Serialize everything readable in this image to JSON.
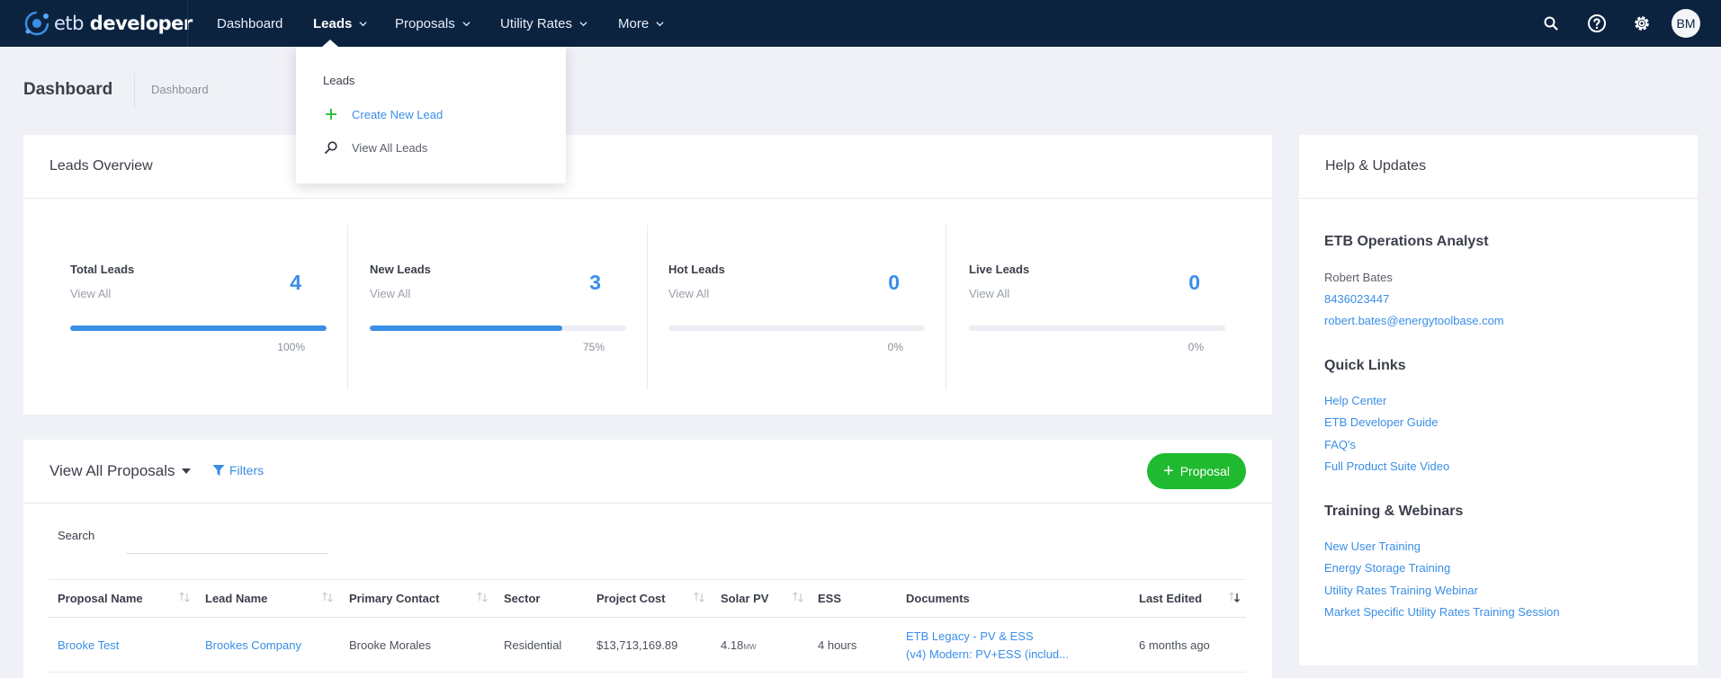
{
  "brand": {
    "prefix": "etb",
    "name": "developer"
  },
  "nav": {
    "items": [
      {
        "label": "Dashboard"
      },
      {
        "label": "Leads"
      },
      {
        "label": "Proposals"
      },
      {
        "label": "Utility Rates"
      },
      {
        "label": "More"
      }
    ],
    "user_initials": "BM"
  },
  "leads_menu": {
    "heading": "Leads",
    "create": "Create New Lead",
    "view_all": "View All Leads"
  },
  "page": {
    "title": "Dashboard",
    "breadcrumb": "Dashboard"
  },
  "leads_overview": {
    "title": "Leads Overview",
    "stats": [
      {
        "label": "Total Leads",
        "link": "View All",
        "value": "4",
        "percent_text": "100%",
        "fill": 1.0
      },
      {
        "label": "New Leads",
        "link": "View All",
        "value": "3",
        "percent_text": "75%",
        "fill": 0.75
      },
      {
        "label": "Hot Leads",
        "link": "View All",
        "value": "0",
        "percent_text": "0%",
        "fill": 0.0
      },
      {
        "label": "Live Leads",
        "link": "View All",
        "value": "0",
        "percent_text": "0%",
        "fill": 0.0
      }
    ]
  },
  "proposals": {
    "title": "View All Proposals",
    "filters_label": "Filters",
    "add_button": "Proposal",
    "search_label": "Search",
    "search_value": "",
    "columns": [
      "Proposal Name",
      "Lead Name",
      "Primary Contact",
      "Sector",
      "Project Cost",
      "Solar PV",
      "ESS",
      "Documents",
      "Last Edited"
    ],
    "rows": [
      {
        "proposal_name": "Brooke Test",
        "lead_name": "Brookes Company",
        "primary_contact": "Brooke Morales",
        "sector": "Residential",
        "project_cost": "$13,713,169.89",
        "solar_pv": "4.18",
        "solar_pv_unit": "MW",
        "ess": "4 hours",
        "documents": [
          "ETB Legacy - PV & ESS",
          "(v4) Modern: PV+ESS (includ..."
        ],
        "last_edited": "6 months ago"
      }
    ]
  },
  "help": {
    "title": "Help & Updates",
    "analyst_heading": "ETB Operations Analyst",
    "analyst_name": "Robert Bates",
    "analyst_phone": "8436023447",
    "analyst_email": "robert.bates@energytoolbase.com",
    "quick_links_heading": "Quick Links",
    "quick_links": [
      "Help Center",
      "ETB Developer Guide",
      "FAQ's",
      "Full Product Suite Video"
    ],
    "training_heading": "Training & Webinars",
    "training_links": [
      "New User Training",
      "Energy Storage Training",
      "Utility Rates Training Webinar",
      "Market Specific Utility Rates Training Session"
    ]
  },
  "colors": {
    "navbar": "#0c2340",
    "accent": "#3a8ee6",
    "success": "#1fba2f",
    "background": "#f0f1f6"
  }
}
